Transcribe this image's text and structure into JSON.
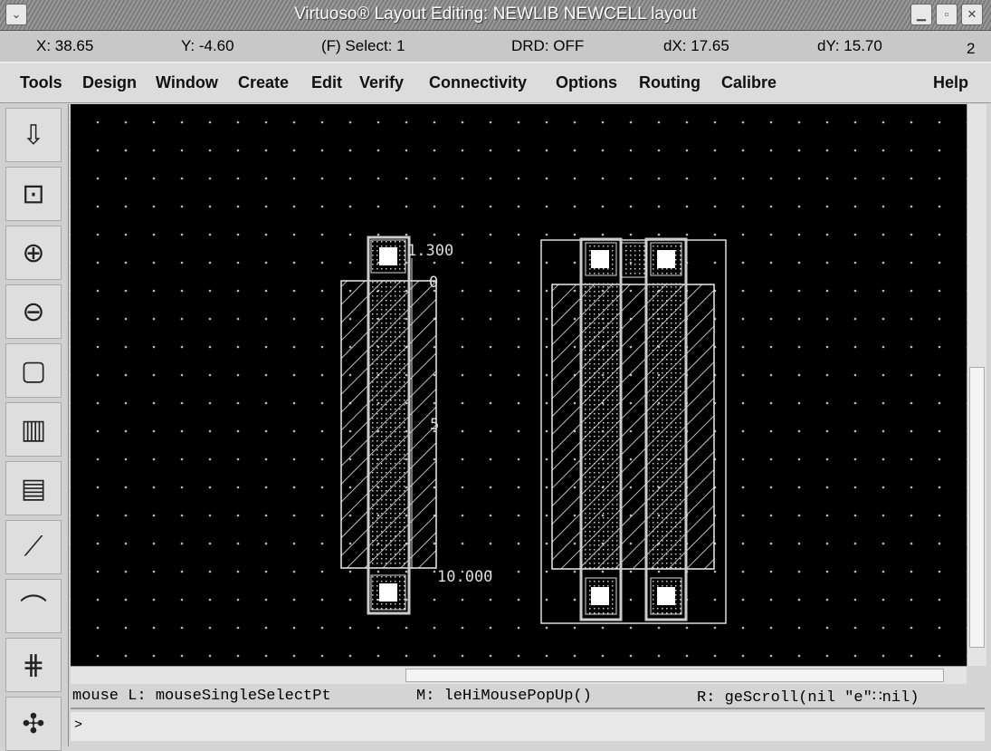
{
  "window": {
    "title": "Virtuoso® Layout Editing: NEWLIB NEWCELL layout",
    "controls": [
      "minimize",
      "maximize",
      "close"
    ]
  },
  "status": {
    "x": "X: 38.65",
    "y": "Y: -4.60",
    "select": "(F) Select: 1",
    "drd": "DRD: OFF",
    "dx": "dX: 17.65",
    "dy": "dY: 15.70",
    "num": "2"
  },
  "menu": [
    "Tools",
    "Design",
    "Window",
    "Create",
    "Edit",
    "Verify",
    "Connectivity",
    "Options",
    "Routing",
    "Calibre",
    "Help"
  ],
  "toolbar": [
    {
      "icon": "save-icon",
      "glyph": "⇩"
    },
    {
      "icon": "zoom-fit-icon",
      "glyph": "⊡"
    },
    {
      "icon": "zoom-in-icon",
      "glyph": "⊕"
    },
    {
      "icon": "zoom-out-icon",
      "glyph": "⊖"
    },
    {
      "icon": "select-box-icon",
      "glyph": "▢"
    },
    {
      "icon": "multi-select-icon",
      "glyph": "▥"
    },
    {
      "icon": "partial-select-icon",
      "glyph": "▤"
    },
    {
      "icon": "path-icon",
      "glyph": "⟋"
    },
    {
      "icon": "arc-icon",
      "glyph": "⌒"
    },
    {
      "icon": "pins-icon",
      "glyph": "⋕"
    },
    {
      "icon": "misc-icon",
      "glyph": "✣"
    }
  ],
  "ruler": {
    "top": "1.300",
    "zero": "0",
    "mid": "5",
    "bottom": "10.000"
  },
  "mouse": {
    "left": "mouse L: mouseSingleSelectPt",
    "middle": "M: leHiMousePopUp()",
    "right": "R: geScroll(nil \"e\"∷nil)"
  },
  "command": {
    "prompt": ">",
    "value": ""
  }
}
